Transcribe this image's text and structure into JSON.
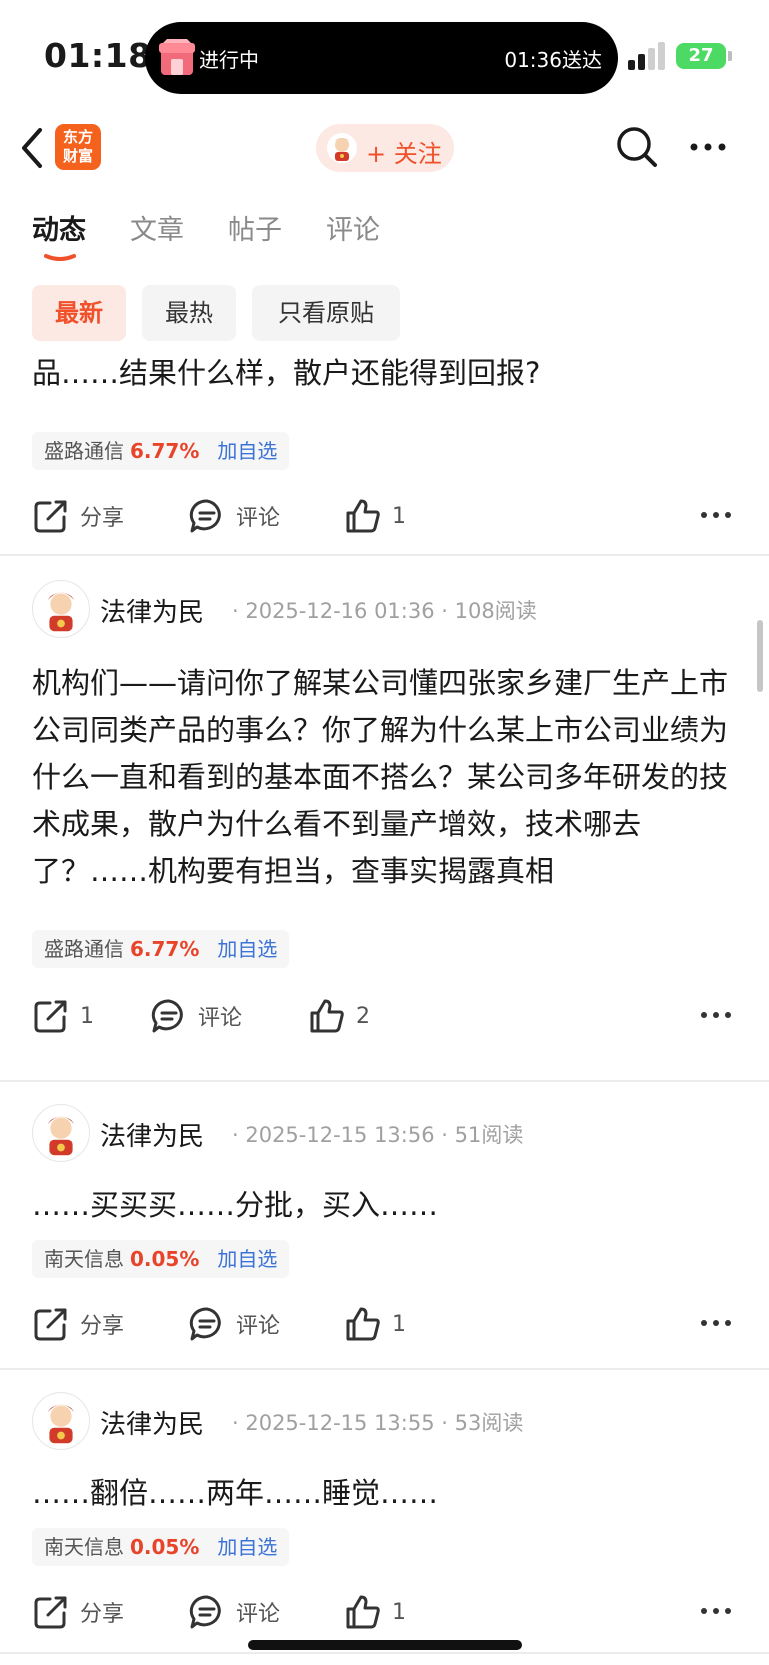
{
  "status_bar": {
    "time": "01:18",
    "live_activity_label": "进行中",
    "live_activity_eta": "01:36送达",
    "battery": "27"
  },
  "navbar": {
    "logo_line1": "东方",
    "logo_line2": "财富",
    "follow_label": "+ 关注"
  },
  "tabs": [
    {
      "label": "动态",
      "active": true
    },
    {
      "label": "文章",
      "active": false
    },
    {
      "label": "帖子",
      "active": false
    },
    {
      "label": "评论",
      "active": false
    }
  ],
  "filters": [
    {
      "label": "最新",
      "active": true
    },
    {
      "label": "最热",
      "active": false
    },
    {
      "label": "只看原贴",
      "active": false
    }
  ],
  "posts": [
    {
      "content": "品……结果什么样，散户还能得到回报?",
      "stock": {
        "name": "盛路通信",
        "change": "6.77%",
        "add_label": "加自选"
      },
      "actions": {
        "share": "分享",
        "comment": "评论",
        "likes": "1"
      }
    },
    {
      "author": "法律为民",
      "meta": "· 2025-12-16 01:36 · 108阅读",
      "content": "机构们——请问你了解某公司懂四张家乡建厂生产上市公司同类产品的事么？你了解为什么某上市公司业绩为什么一直和看到的基本面不搭么？某公司多年研发的技术成果，散户为什么看不到量产增效，技术哪去了？……机构要有担当，查事实揭露真相",
      "stock": {
        "name": "盛路通信",
        "change": "6.77%",
        "add_label": "加自选"
      },
      "actions": {
        "share": "1",
        "comment": "评论",
        "likes": "2"
      }
    },
    {
      "author": "法律为民",
      "meta": "· 2025-12-15 13:56 · 51阅读",
      "content": "……买买买……分批，买入……",
      "stock": {
        "name": "南天信息",
        "change": "0.05%",
        "add_label": "加自选"
      },
      "actions": {
        "share": "分享",
        "comment": "评论",
        "likes": "1"
      }
    },
    {
      "author": "法律为民",
      "meta": "· 2025-12-15 13:55 · 53阅读",
      "content": "……翻倍……两年……睡觉……",
      "stock": {
        "name": "南天信息",
        "change": "0.05%",
        "add_label": "加自选"
      },
      "actions": {
        "share": "分享",
        "comment": "评论",
        "likes": "1"
      }
    }
  ],
  "colors": {
    "accent": "#f0502a",
    "stock_up": "#e8442a",
    "link_blue": "#3b73d6",
    "logo_orange": "#f5621e"
  }
}
